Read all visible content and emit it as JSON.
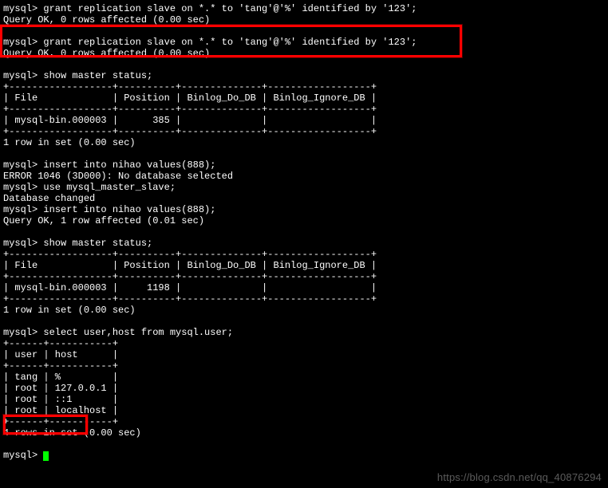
{
  "lines": {
    "l0": "mysql> grant replication slave on *.* to 'tang'@'%' identified by '123';",
    "l1": "Query OK, 0 rows affected (0.00 sec)",
    "l2": "",
    "l3": "mysql> grant replication slave on *.* to 'tang'@'%' identified by '123';",
    "l4": "Query OK, 0 rows affected (0.00 sec)",
    "l5": "",
    "l6": "mysql> show master status;",
    "l7": "+------------------+----------+--------------+------------------+",
    "l8": "| File             | Position | Binlog_Do_DB | Binlog_Ignore_DB |",
    "l9": "+------------------+----------+--------------+------------------+",
    "l10": "| mysql-bin.000003 |      385 |              |                  |",
    "l11": "+------------------+----------+--------------+------------------+",
    "l12": "1 row in set (0.00 sec)",
    "l13": "",
    "l14": "mysql> insert into nihao values(888);",
    "l15": "ERROR 1046 (3D000): No database selected",
    "l16": "mysql> use mysql_master_slave;",
    "l17": "Database changed",
    "l18": "mysql> insert into nihao values(888);",
    "l19": "Query OK, 1 row affected (0.01 sec)",
    "l20": "",
    "l21": "mysql> show master status;",
    "l22": "+------------------+----------+--------------+------------------+",
    "l23": "| File             | Position | Binlog_Do_DB | Binlog_Ignore_DB |",
    "l24": "+------------------+----------+--------------+------------------+",
    "l25": "| mysql-bin.000003 |     1198 |              |                  |",
    "l26": "+------------------+----------+--------------+------------------+",
    "l27": "1 row in set (0.00 sec)",
    "l28": "",
    "l29": "mysql> select user,host from mysql.user;",
    "l30": "+------+-----------+",
    "l31": "| user | host      |",
    "l32": "+------+-----------+",
    "l33": "| tang | %         |",
    "l34": "| root | 127.0.0.1 |",
    "l35": "| root | ::1       |",
    "l36": "| root | localhost |",
    "l37": "+------+-----------+",
    "l38": "4 rows in set (0.00 sec)",
    "l39": "",
    "l40": "mysql> "
  },
  "watermark": "https://blog.csdn.net/qq_40876294"
}
